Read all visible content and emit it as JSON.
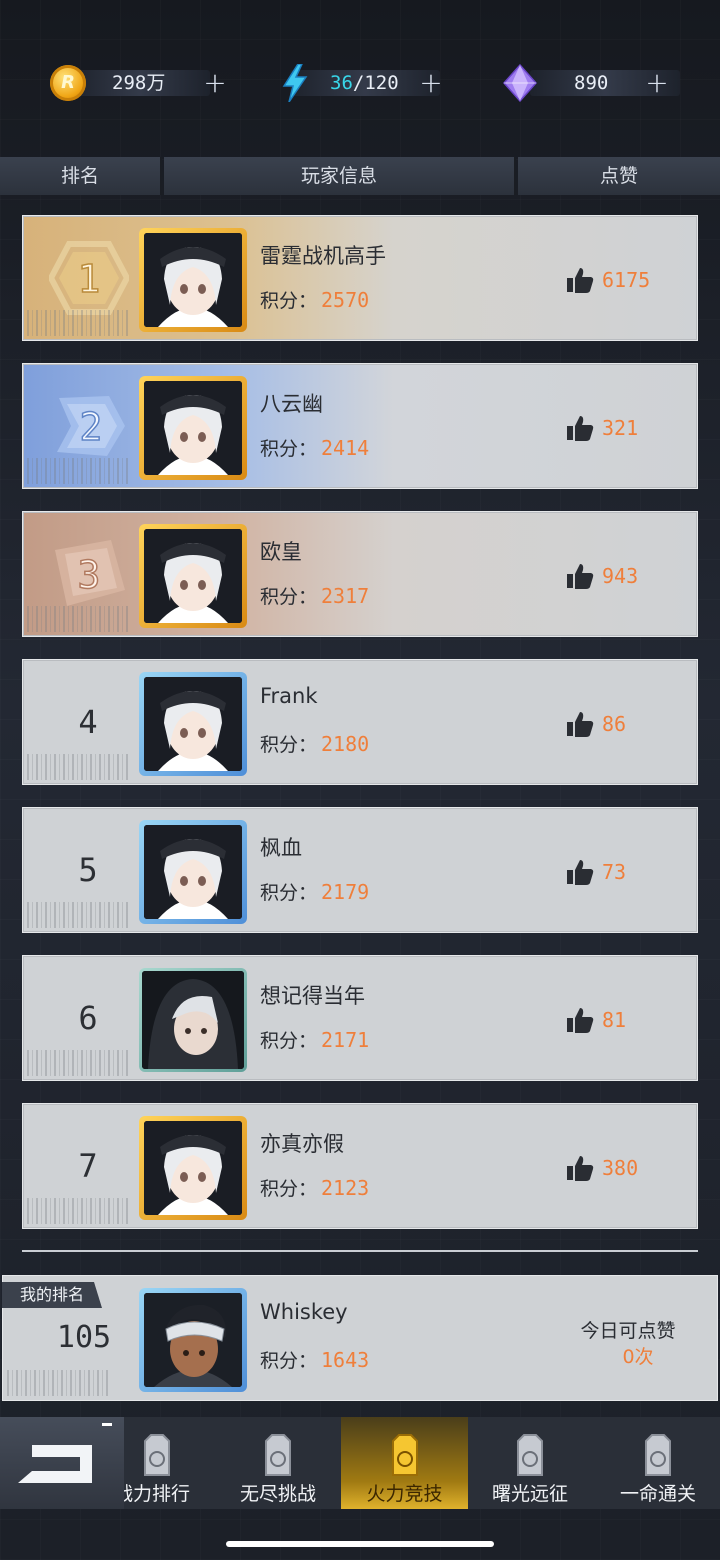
{
  "resources": {
    "coins": "298万",
    "energy_current": "36",
    "energy_rest": "/120",
    "gems": "890",
    "plus": "+"
  },
  "header": {
    "rank": "排名",
    "player": "玩家信息",
    "likes": "点赞"
  },
  "score_label": "积分：",
  "players": [
    {
      "rank": "1",
      "name": "雷霆战机高手",
      "score": "2570",
      "likes": "6175"
    },
    {
      "rank": "2",
      "name": "八云幽",
      "score": "2414",
      "likes": "321"
    },
    {
      "rank": "3",
      "name": "欧皇",
      "score": "2317",
      "likes": "943"
    },
    {
      "rank": "4",
      "name": "Frank",
      "score": "2180",
      "likes": "86"
    },
    {
      "rank": "5",
      "name": "枫血",
      "score": "2179",
      "likes": "73"
    },
    {
      "rank": "6",
      "name": "想记得当年",
      "score": "2171",
      "likes": "81"
    },
    {
      "rank": "7",
      "name": "亦真亦假",
      "score": "2123",
      "likes": "380"
    }
  ],
  "my_rank": {
    "tag": "我的排名",
    "rank": "105",
    "name": "Whiskey",
    "score": "1643",
    "today_label": "今日可点赞",
    "today_count": "0次"
  },
  "nav": [
    {
      "label": "战力排行",
      "active": false
    },
    {
      "label": "无尽挑战",
      "active": false
    },
    {
      "label": "火力竞技",
      "active": true
    },
    {
      "label": "曙光远征",
      "active": false
    },
    {
      "label": "一命通关",
      "active": false
    }
  ],
  "colors": {
    "accent": "#ef7f3b",
    "energy": "#38d6e8",
    "gold": "#e0b22c"
  }
}
